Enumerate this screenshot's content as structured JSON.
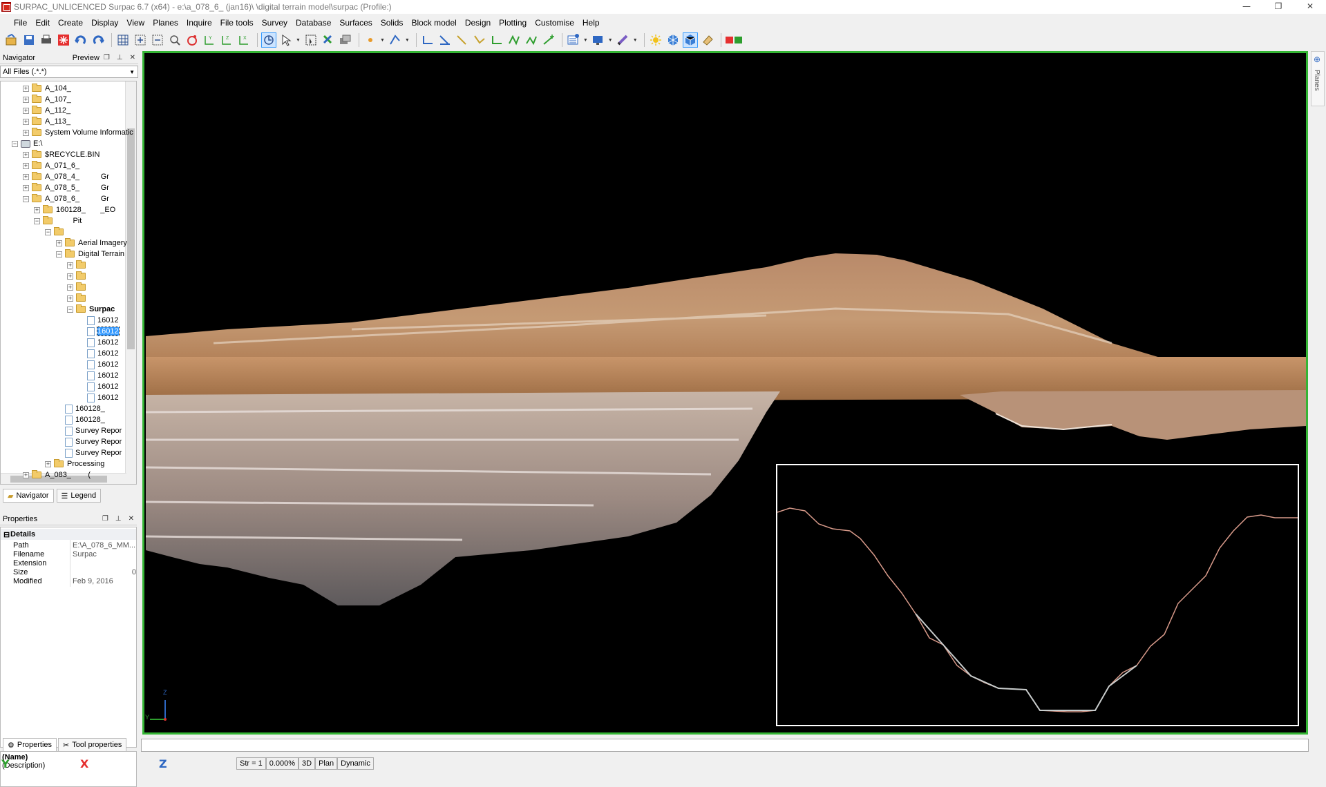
{
  "window": {
    "title": "SURPAC_UNLICENCED Surpac 6.7 (x64) - e:\\a_078_6_        (jan16)\\                \\digital terrain model\\surpac (Profile:)"
  },
  "menu": [
    "File",
    "Edit",
    "Create",
    "Display",
    "View",
    "Planes",
    "Inquire",
    "File tools",
    "Survey",
    "Database",
    "Surfaces",
    "Solids",
    "Block model",
    "Design",
    "Plotting",
    "Customise",
    "Help"
  ],
  "navigator": {
    "title": "Navigator",
    "preview_label": "Preview",
    "filter": "All Files (.*.*)",
    "tree": [
      {
        "label": "A_104_",
        "type": "folder",
        "level": 1,
        "exp": "+"
      },
      {
        "label": "A_107_",
        "type": "folder",
        "level": 1,
        "exp": "+"
      },
      {
        "label": "A_112_",
        "type": "folder",
        "level": 1,
        "exp": "+"
      },
      {
        "label": "A_113_",
        "type": "folder",
        "level": 1,
        "exp": "+"
      },
      {
        "label": "System Volume Informatic",
        "type": "folder",
        "level": 1,
        "exp": "+"
      },
      {
        "label": "E:\\",
        "type": "drive",
        "level": 0,
        "exp": "-"
      },
      {
        "label": "$RECYCLE.BIN",
        "type": "folder",
        "level": 1,
        "exp": "+"
      },
      {
        "label": "A_071_6_",
        "type": "folder",
        "level": 1,
        "exp": "+"
      },
      {
        "label": "A_078_4_          Gr",
        "type": "folder",
        "level": 1,
        "exp": "+"
      },
      {
        "label": "A_078_5_          Gr",
        "type": "folder",
        "level": 1,
        "exp": "+"
      },
      {
        "label": "A_078_6_          Gr",
        "type": "folder",
        "level": 1,
        "exp": "-"
      },
      {
        "label": "160128_       _EO",
        "type": "folder",
        "level": 2,
        "exp": "+"
      },
      {
        "label": "        Pit",
        "type": "folder",
        "level": 2,
        "exp": "-"
      },
      {
        "label": "",
        "type": "folder",
        "level": 3,
        "exp": "-"
      },
      {
        "label": "Aerial Imagery",
        "type": "folder",
        "level": 4,
        "exp": "+"
      },
      {
        "label": "Digital Terrain",
        "type": "folder",
        "level": 4,
        "exp": "-"
      },
      {
        "label": "",
        "type": "folder",
        "level": 5,
        "exp": "+"
      },
      {
        "label": "",
        "type": "folder",
        "level": 5,
        "exp": "+"
      },
      {
        "label": "",
        "type": "folder",
        "level": 5,
        "exp": "+"
      },
      {
        "label": "",
        "type": "folder",
        "level": 5,
        "exp": "+"
      },
      {
        "label": "Surpac",
        "type": "folder",
        "level": 5,
        "exp": "-",
        "bold": true
      },
      {
        "label": "16012",
        "type": "file",
        "level": 6
      },
      {
        "label": "16012",
        "type": "file",
        "level": 6,
        "selected": true
      },
      {
        "label": "16012",
        "type": "file",
        "level": 6
      },
      {
        "label": "16012",
        "type": "file",
        "level": 6
      },
      {
        "label": "16012",
        "type": "file",
        "level": 6
      },
      {
        "label": "16012",
        "type": "file",
        "level": 6
      },
      {
        "label": "16012",
        "type": "file",
        "level": 6
      },
      {
        "label": "16012",
        "type": "file",
        "level": 6
      },
      {
        "label": "160128_",
        "type": "file",
        "level": 4
      },
      {
        "label": "160128_",
        "type": "file",
        "level": 4
      },
      {
        "label": "Survey Repor",
        "type": "file",
        "level": 4
      },
      {
        "label": "Survey Repor",
        "type": "file",
        "level": 4
      },
      {
        "label": "Survey Repor",
        "type": "file",
        "level": 4
      },
      {
        "label": "Processing",
        "type": "folder",
        "level": 3,
        "exp": "+"
      },
      {
        "label": "A_083_        (",
        "type": "folder",
        "level": 1,
        "exp": "+"
      }
    ],
    "tabs": [
      "Navigator",
      "Legend"
    ]
  },
  "properties": {
    "title": "Properties",
    "section": "Details",
    "rows": [
      {
        "key": "Path",
        "value": "E:\\A_078_6_MM..."
      },
      {
        "key": "Filename",
        "value": "Surpac"
      },
      {
        "key": "Extension",
        "value": ""
      },
      {
        "key": "Size",
        "value": "0"
      },
      {
        "key": "Modified",
        "value": "Feb 9, 2016"
      }
    ],
    "name_label": "(Name)",
    "description_label": "(Description)",
    "tabs": [
      "Properties",
      "Tool properties"
    ]
  },
  "viewport": {
    "axis_z": "Z",
    "axis_y": "Y",
    "planes_label": "Planes"
  },
  "status": {
    "y_label": "Y",
    "x_label": "X",
    "z_label": "Z",
    "str": "Str = 1",
    "percent": "0.000%",
    "mode_3d": "3D",
    "plan": "Plan",
    "dynamic": "Dynamic"
  },
  "colors": {
    "viewport_border": "#35b535",
    "background": "#000000",
    "selection": "#3399ff"
  }
}
